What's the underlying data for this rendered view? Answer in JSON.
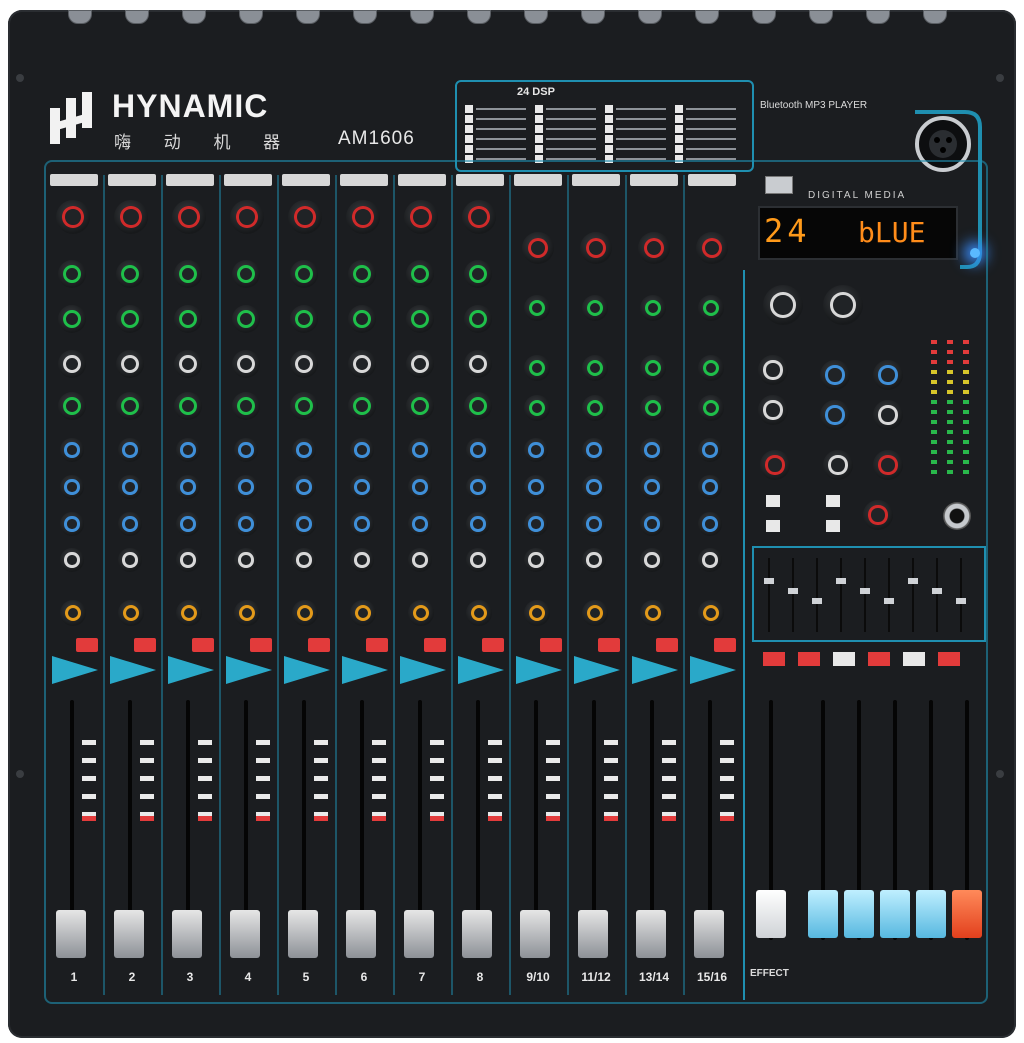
{
  "brand": {
    "name": "HYNAMIC",
    "subtitle": "嗨 动 机 器",
    "model": "AM1606"
  },
  "dsp": {
    "title": "24 DSP"
  },
  "bluetooth": {
    "title": "Bluetooth MP3 PLAYER"
  },
  "display": {
    "number": "24",
    "text": "bLUE"
  },
  "digital_label": "DIGITAL MEDIA",
  "channels": [
    {
      "label": "1"
    },
    {
      "label": "2"
    },
    {
      "label": "3"
    },
    {
      "label": "4"
    },
    {
      "label": "5"
    },
    {
      "label": "6"
    },
    {
      "label": "7"
    },
    {
      "label": "8"
    },
    {
      "label": "9/10"
    },
    {
      "label": "11/12"
    },
    {
      "label": "13/14"
    },
    {
      "label": "15/16"
    }
  ],
  "effect_label": "EFFECT",
  "colors": {
    "body": "#1b1d20",
    "accent": "#1f8fb0",
    "display_text": "#ff9a1a",
    "mute": "#e23b3b"
  }
}
